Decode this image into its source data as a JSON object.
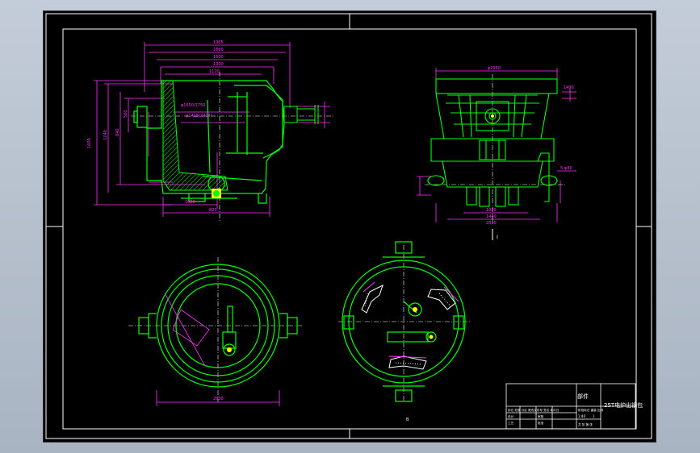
{
  "app": {
    "viewport_background": "#000000",
    "workspace_background": "#b8c2cf"
  },
  "colors": {
    "frame": "#ffffff",
    "outline": "#00ff00",
    "dimension": "#ff33ff",
    "center_line": "#ffffff",
    "cyan": "#00ffff",
    "yellow": "#ffff00"
  },
  "drawing": {
    "view_label": "I-I",
    "section_label": "I",
    "center_mark": "B",
    "dims": {
      "top_width_1": "1965",
      "top_width_2": "1860",
      "top_width_3": "1600",
      "top_width_4": "1300",
      "inner_width": "1120",
      "left_height_1": "1600",
      "left_height_2": "1240",
      "left_height_3": "840",
      "left_height_4": "560",
      "slag_level": "φ1650/1750",
      "steel_level": "φ1415(2414)",
      "bottom_1": "1000",
      "bottom_2": "820",
      "right_top": "φ2950",
      "right_side": "1490",
      "right_small": "5-φ40",
      "right_bottom_1": "1020",
      "right_bottom_2": "1440",
      "right_bottom_3": "2830",
      "plan_width": "2830"
    }
  },
  "title_block": {
    "part_label": "部件",
    "drawing_name": "25T电炉出钢包",
    "scale": "1:40",
    "sheet": "1",
    "designer": "设计",
    "checker": "审核",
    "process": "工艺",
    "approve": "批准",
    "count_row": "共 张 第 张",
    "mark_row": "标记 处数 分区 更改文件号 签名 年月日",
    "stage_row": "阶段标记 重量 比例"
  }
}
